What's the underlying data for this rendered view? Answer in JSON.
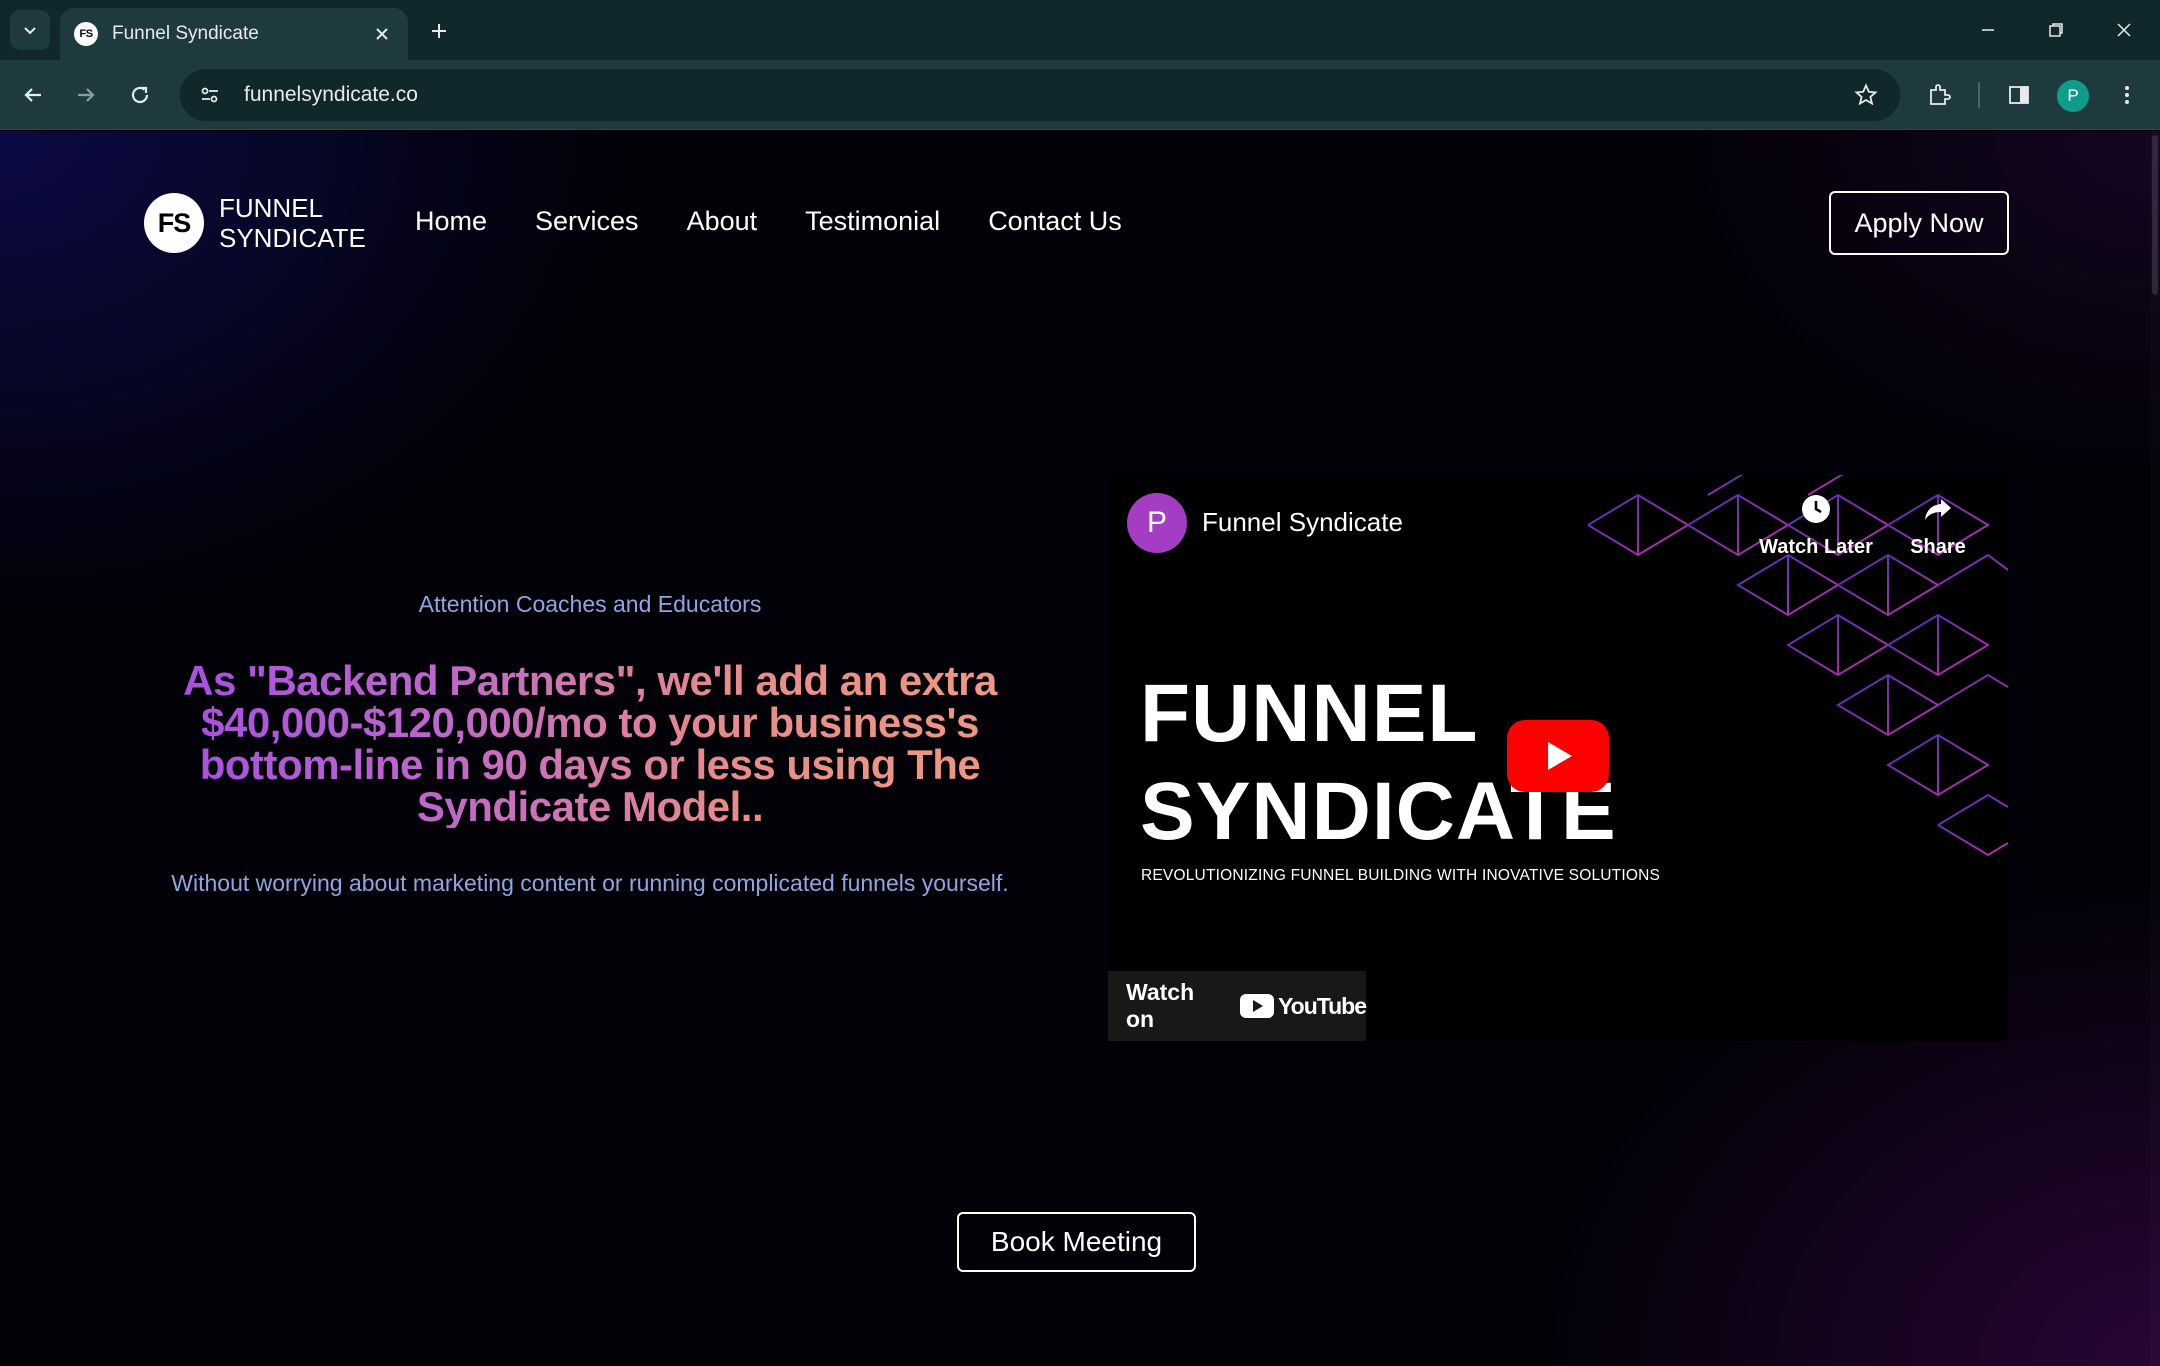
{
  "browser": {
    "tab": {
      "favicon_text": "FS",
      "title": "Funnel Syndicate"
    },
    "url": "funnelsyndicate.co",
    "profile_initial": "P",
    "icons": [
      "tab-search-icon",
      "close-icon",
      "plus-icon",
      "minimize-icon",
      "restore-icon",
      "window-close-icon",
      "back-icon",
      "forward-icon",
      "reload-icon",
      "site-info-icon",
      "star-icon",
      "extensions-icon",
      "side-panel-icon",
      "menu-icon"
    ]
  },
  "site": {
    "logo_badge": "FS",
    "logo_line1": "FUNNEL",
    "logo_line2": "SYNDICATE",
    "nav": [
      "Home",
      "Services",
      "About",
      "Testimonial",
      "Contact Us"
    ],
    "apply_label": "Apply Now",
    "hero": {
      "eyebrow": "Attention Coaches and Educators",
      "headline": "As \"Backend Partners\", we'll add an extra $40,000-$120,000/mo to your business's bottom-line in 90 days or less using The Syndicate Model..",
      "subline": "Without worrying about marketing content or running complicated funnels yourself."
    },
    "video": {
      "avatar_initial": "P",
      "channel": "Funnel Syndicate",
      "watch_later": "Watch Later",
      "share": "Share",
      "title_line1": "FUNNEL",
      "title_line2": "SYNDICATE",
      "tagline": "REVOLUTIONIZING FUNNEL BUILDING WITH INOVATIVE SOLUTIONS",
      "watch_on": "Watch on",
      "youtube_word": "YouTube"
    },
    "book_label": "Book Meeting"
  },
  "colors": {
    "tab_strip": "#10272b",
    "toolbar": "#1f3a3f",
    "accent_text": "#8fa6e0",
    "headline_gradient": [
      "#a34be6",
      "#f09a80"
    ],
    "youtube_red": "#ff0000",
    "cube_lines": "#6b2fb0"
  }
}
